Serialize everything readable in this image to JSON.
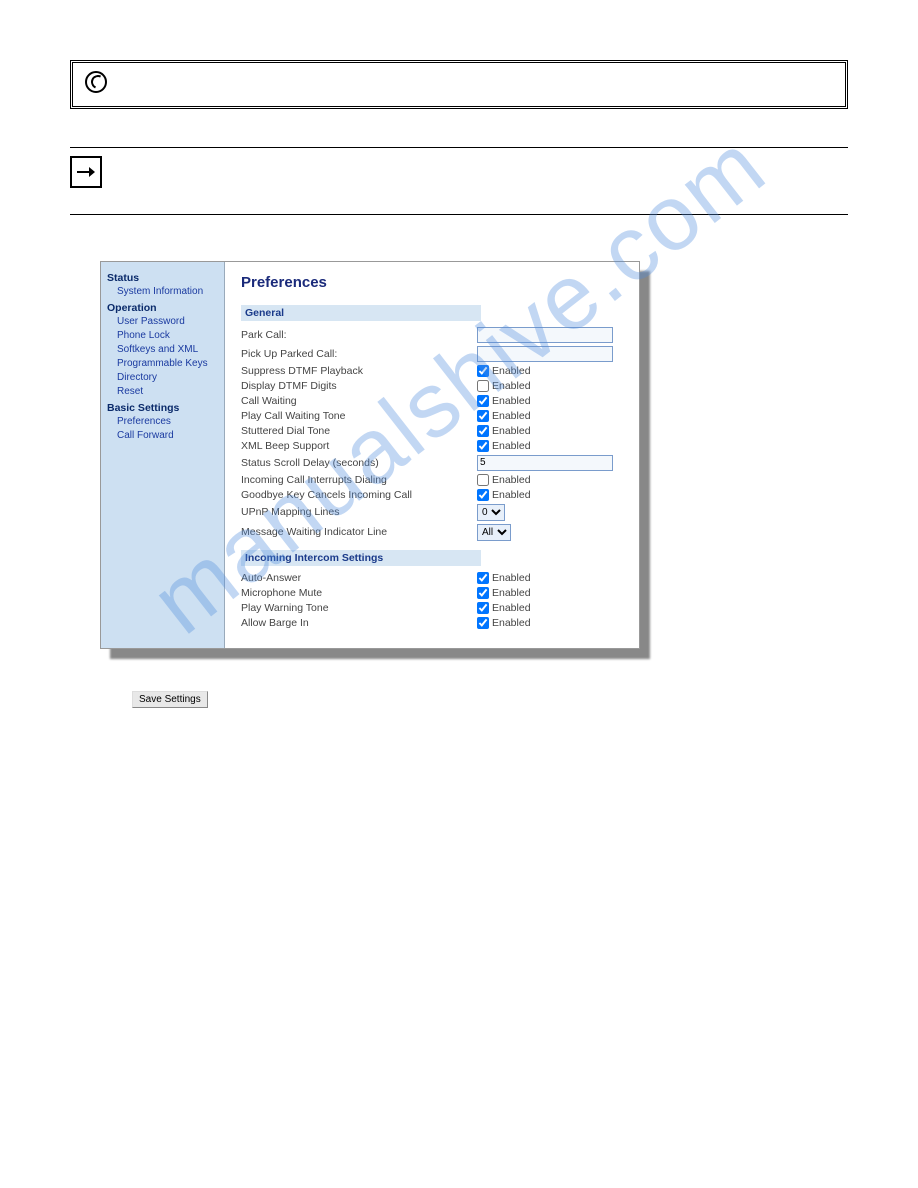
{
  "watermark": "manualshive.com",
  "sidebar": {
    "groups": [
      {
        "head": "Status",
        "items": [
          "System Information"
        ]
      },
      {
        "head": "Operation",
        "items": [
          "User Password",
          "Phone Lock",
          "Softkeys and XML",
          "Programmable Keys",
          "Directory",
          "Reset"
        ]
      },
      {
        "head": "Basic Settings",
        "items": [
          "Preferences",
          "Call Forward"
        ]
      }
    ]
  },
  "main": {
    "title": "Preferences",
    "sections": [
      {
        "head": "General",
        "rows": [
          {
            "label": "Park Call:",
            "type": "text",
            "value": ""
          },
          {
            "label": "Pick Up Parked Call:",
            "type": "text",
            "value": ""
          },
          {
            "label": "Suppress DTMF Playback",
            "type": "check",
            "checked": true,
            "text": "Enabled"
          },
          {
            "label": "Display DTMF Digits",
            "type": "check",
            "checked": false,
            "text": "Enabled"
          },
          {
            "label": "Call Waiting",
            "type": "check",
            "checked": true,
            "text": "Enabled"
          },
          {
            "label": "Play Call Waiting Tone",
            "type": "check",
            "checked": true,
            "text": "Enabled"
          },
          {
            "label": "Stuttered Dial Tone",
            "type": "check",
            "checked": true,
            "text": "Enabled"
          },
          {
            "label": "XML Beep Support",
            "type": "check",
            "checked": true,
            "text": "Enabled"
          },
          {
            "label": "Status Scroll Delay (seconds)",
            "type": "text",
            "value": "5"
          },
          {
            "label": "Incoming Call Interrupts Dialing",
            "type": "check",
            "checked": false,
            "text": "Enabled"
          },
          {
            "label": "Goodbye Key Cancels Incoming Call",
            "type": "check",
            "checked": true,
            "text": "Enabled"
          },
          {
            "label": "UPnP Mapping Lines",
            "type": "select",
            "value": "0"
          },
          {
            "label": "Message Waiting Indicator Line",
            "type": "select",
            "value": "All"
          }
        ]
      },
      {
        "head": "Incoming Intercom Settings",
        "rows": [
          {
            "label": "Auto-Answer",
            "type": "check",
            "checked": true,
            "text": "Enabled"
          },
          {
            "label": "Microphone Mute",
            "type": "check",
            "checked": true,
            "text": "Enabled"
          },
          {
            "label": "Play Warning Tone",
            "type": "check",
            "checked": true,
            "text": "Enabled"
          },
          {
            "label": "Allow Barge In",
            "type": "check",
            "checked": true,
            "text": "Enabled"
          }
        ]
      }
    ]
  },
  "save_button": "Save Settings"
}
